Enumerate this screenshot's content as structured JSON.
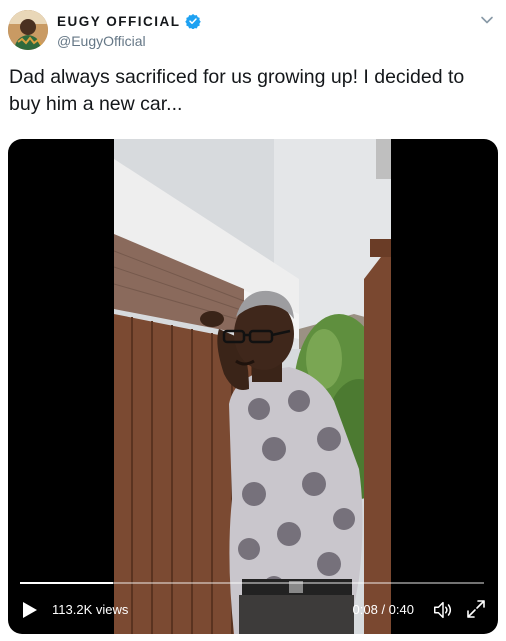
{
  "author": {
    "display_name": "EUGY OFFICIAL",
    "handle": "@EugyOfficial",
    "verified_icon": "verified-badge-icon",
    "avatar_icon": "avatar"
  },
  "tweet": {
    "text": "Dad always sacrificed for us growing up! I decided to buy him a new car..."
  },
  "video": {
    "views": "113.2K views",
    "time": "0:08 / 0:40",
    "progress_fraction": 0.2,
    "icons": [
      "play-icon",
      "volume-icon",
      "fullscreen-icon"
    ]
  },
  "colors": {
    "verified": "#1da1f2",
    "handle": "#657786",
    "text": "#14171a",
    "video_bg": "#000000"
  }
}
